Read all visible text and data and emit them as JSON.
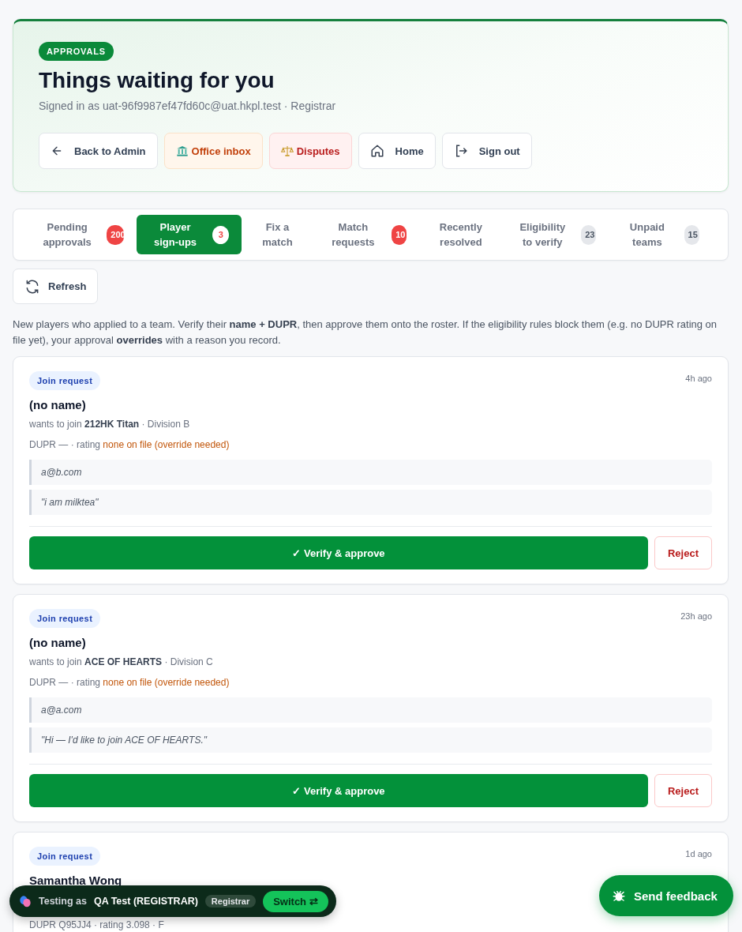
{
  "header": {
    "tag": "APPROVALS",
    "title": "Things waiting for you",
    "subtitle": "Signed in as uat-96f9987ef47fd60c@uat.hkpl.test · Registrar",
    "buttons": [
      {
        "label": "Back to Admin",
        "kind": "plain"
      },
      {
        "label": "Office inbox",
        "kind": "orange"
      },
      {
        "label": "Disputes",
        "kind": "red"
      },
      {
        "label": "Home",
        "kind": "plain"
      },
      {
        "label": "Sign out",
        "kind": "plain"
      }
    ]
  },
  "tabs": [
    {
      "label": "Pending approvals",
      "badge": "200",
      "kind": "alert",
      "selected": false
    },
    {
      "label": "Player sign-ups",
      "badge": "3",
      "kind": "alert",
      "selected": true
    },
    {
      "label": "Fix a match",
      "selected": false
    },
    {
      "label": "Match requests",
      "badge": "10",
      "kind": "alert",
      "selected": false
    },
    {
      "label": "Recently resolved",
      "selected": false
    },
    {
      "label": "Eligibility to verify",
      "badge": "23",
      "kind": "muted",
      "selected": false
    },
    {
      "label": "Unpaid teams",
      "badge": "15",
      "kind": "muted",
      "selected": false
    }
  ],
  "refresh_button": "Refresh",
  "intro": "New players who applied to a team. Verify their **name + DUPR**, then approve them onto the roster. If the eligibility rules block them (e.g. no DUPR rating on file yet), your approval **overrides** with a reason you record.",
  "requests": [
    {
      "tag": "Join request",
      "time": "4h ago",
      "name": "(no name)",
      "team_line": "wants to join **212HK Titan** · Division B",
      "dupr": "DUPR — · rating ",
      "dupr_status": "none on file (override needed)",
      "notes": [
        "a@b.com",
        "\"i am milktea\""
      ],
      "approve": "✓ Verify & approve",
      "reject": "Reject"
    },
    {
      "tag": "Join request",
      "time": "23h ago",
      "name": "(no name)",
      "team_line": "wants to join **ACE OF HEARTS** · Division C",
      "dupr": "DUPR — · rating ",
      "dupr_status": "none on file (override needed)",
      "notes": [
        "a@a.com",
        "\"Hi — I'd like to join ACE OF HEARTS.\""
      ],
      "approve": "✓ Verify & approve",
      "reject": "Reject"
    },
    {
      "tag": "Join request",
      "time": "1d ago",
      "name": "Samantha Wong",
      "dupr": "DUPR Q95JJ4 · rating 3.098 · F"
    }
  ],
  "test_bar": {
    "label": "Testing as",
    "user": "QA Test (REGISTRAR)",
    "role": "Registrar",
    "switch": "Switch ⇄"
  },
  "feedback_button": "Send feedback"
}
